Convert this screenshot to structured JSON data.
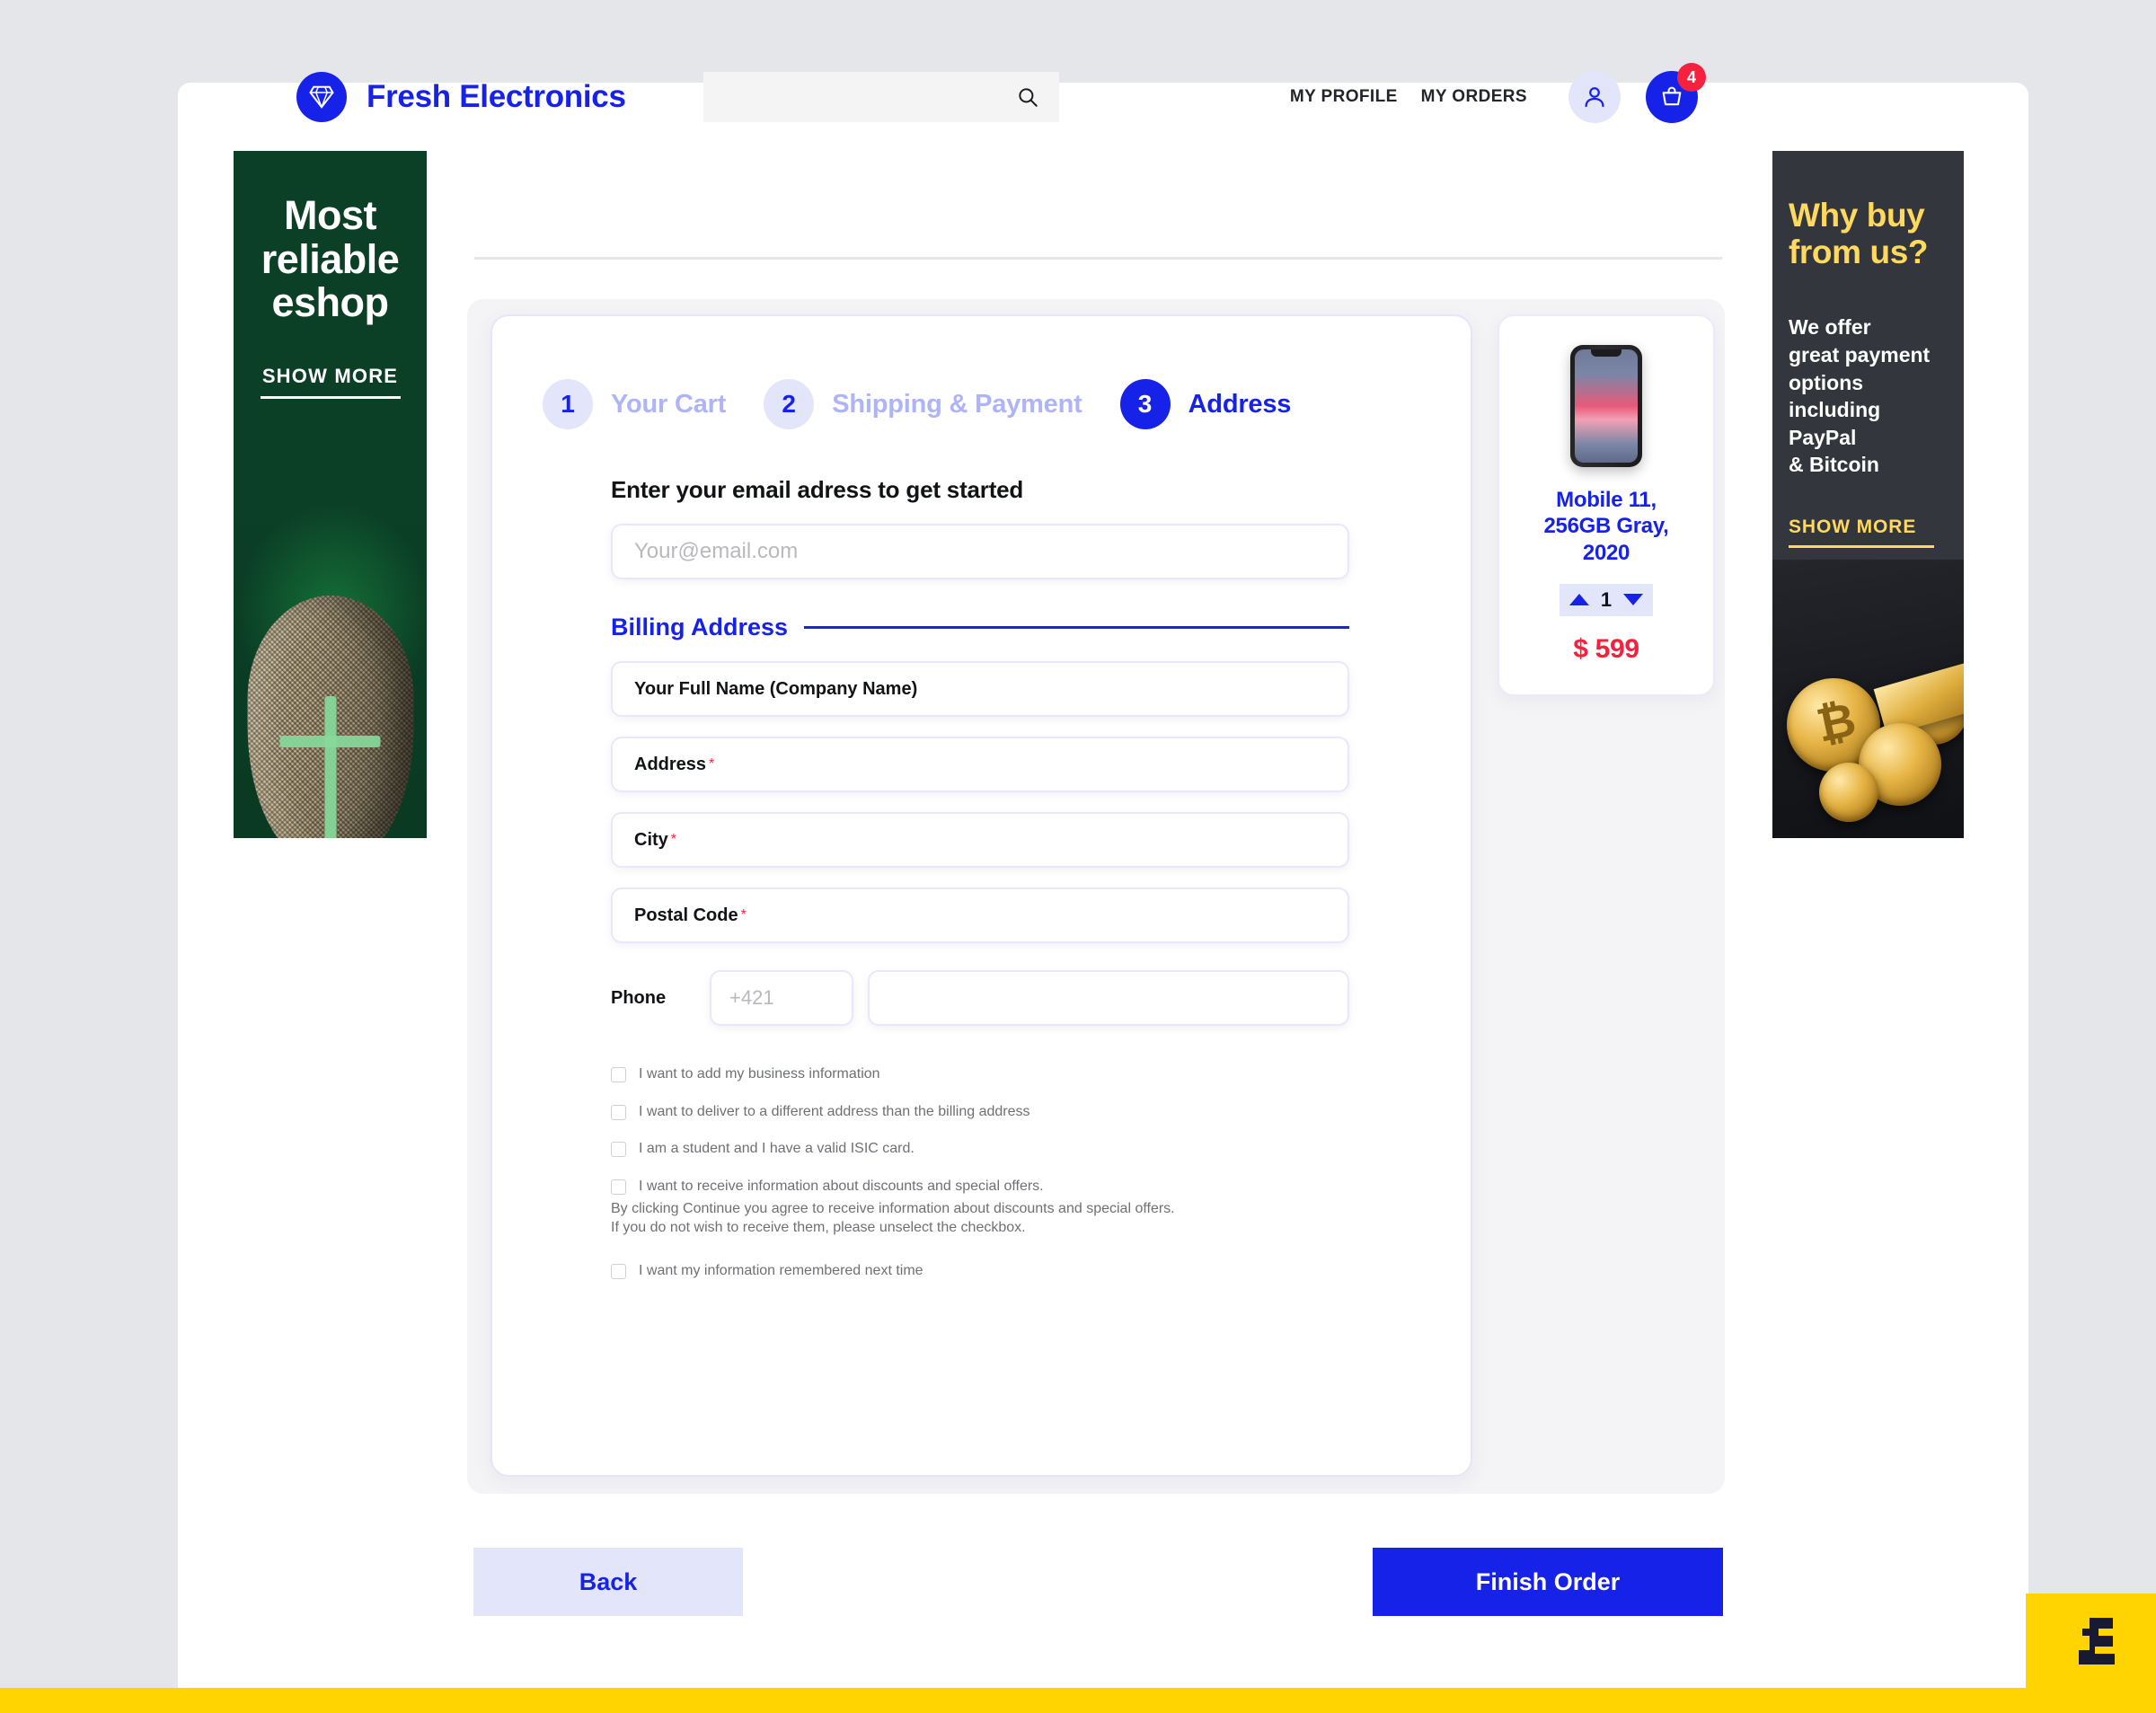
{
  "header": {
    "brand_name": "Fresh Electronics",
    "logo_icon": "diamond-icon",
    "search_placeholder": "",
    "search_value": "",
    "search_icon": "search-icon",
    "nav_links": [
      "MY PROFILE",
      "MY ORDERS"
    ],
    "account_icon": "user-icon",
    "cart_icon": "basket-icon",
    "cart_count": "4"
  },
  "banner_left": {
    "title": "Most reliable eshop",
    "cta": "SHOW MORE"
  },
  "banner_right": {
    "title": "Why buy from us?",
    "body": "We offer\ngreat payment\noptions\nincluding\nPayPal\n& Bitcoin",
    "cta": "SHOW MORE"
  },
  "steps": [
    {
      "number": "1",
      "label": "Your Cart",
      "active": false
    },
    {
      "number": "2",
      "label": "Shipping & Payment",
      "active": false
    },
    {
      "number": "3",
      "label": "Address",
      "active": true
    }
  ],
  "form": {
    "heading": "Enter your email adress to get started",
    "email_placeholder": "Your@email.com",
    "email_value": "",
    "section_title": "Billing Address",
    "fields": [
      {
        "label": "Your Full Name (Company Name)",
        "required": false
      },
      {
        "label": "Address",
        "required": true
      },
      {
        "label": "City",
        "required": true
      },
      {
        "label": "Postal Code",
        "required": true
      }
    ],
    "required_mark": "*",
    "phone_label": "Phone",
    "phone_code_placeholder": "+421",
    "phone_code_value": "",
    "phone_number_value": "",
    "checkboxes": [
      "I want to add my business information",
      "I want to deliver to a different address than the billing address",
      "I am a student and I have a valid ISIC card.",
      "I want to receive information about discounts and special offers.",
      "I want my information remembered next time"
    ],
    "consent_note": "By clicking Continue you agree to receive information about discounts and special offers. If you do not wish to receive them, please unselect the checkbox."
  },
  "product": {
    "title": "Mobile 11, 256GB Gray, 2020",
    "quantity": "1",
    "price": "$ 599",
    "image": "smartphone-photo"
  },
  "footer": {
    "back_label": "Back",
    "finish_label": "Finish Order"
  },
  "corner": {
    "logo_icon": "e-logo-icon"
  },
  "colors": {
    "brand_blue": "#1722e8",
    "accent_red": "#f5213f",
    "accent_yellow": "#ffd400",
    "banner_green": "#0b4026",
    "banner_dark": "#33363d",
    "lavender": "#e3e5fb"
  }
}
